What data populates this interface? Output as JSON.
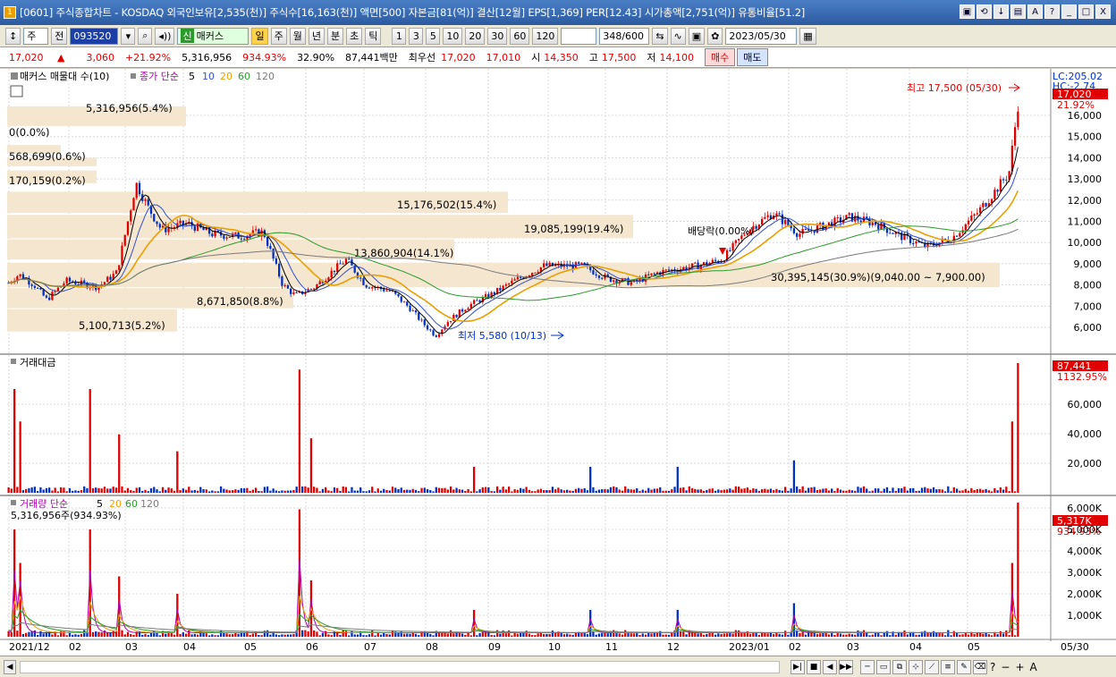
{
  "window": {
    "title": "[0601] 주식종합차트 - KOSDAQ 외국인보유[2,535(천)] 주식수[16,163(천)] 액면[500] 자본금[81(억)] 결산[12월] EPS[1,369] PER[12.43] 시가총액[2,751(억)] 유통비율[51.2]",
    "app_icon": "1",
    "buttons": [
      "▣",
      "⟲",
      "↓",
      "▤",
      "A",
      "?",
      "_",
      "□",
      "X"
    ]
  },
  "toolbar": {
    "type_label": "주",
    "prev_label": "전",
    "code": "093520",
    "name_prefix": "신",
    "name": "매커스",
    "periods": [
      "일",
      "주",
      "월",
      "년",
      "분",
      "초",
      "틱"
    ],
    "intervals": [
      "1",
      "3",
      "5",
      "10",
      "20",
      "30",
      "60",
      "120"
    ],
    "count": "348",
    "count_total": "/600",
    "date": "2023/05/30"
  },
  "quote": {
    "price": "17,020",
    "change_arrow": "▲",
    "change": "3,060",
    "change_pct": "+21.92%",
    "volume": "5,316,956",
    "volume_ratio": "934.93%",
    "turnover": "32.90%",
    "amount": "87,441백만",
    "best_ask_label": "최우선",
    "best_ask": "17,020",
    "best_bid": "17,010",
    "open_label": "시",
    "open": "14,350",
    "high_label": "고",
    "high": "17,500",
    "low_label": "저",
    "low": "14,100",
    "buy_label": "매수",
    "sell_label": "매도"
  },
  "price_panel": {
    "legend_name": "매커스 매물대 수(10)",
    "legend_ma": "종가 단순",
    "ma_periods": [
      "5",
      "10",
      "20",
      "60",
      "120"
    ],
    "lc_label": "LC:205.02",
    "hc_label": "HC:-2.74",
    "current_price": "17,020",
    "current_pct": "21.92%",
    "high_marker": "최고 17,500 (05/30)",
    "low_marker": "최저 5,580 (10/13)",
    "dividend_marker": "배당락(0.00%)",
    "volume_profile_labels": [
      "5,316,956(5.4%)",
      "0(0.0%)",
      "568,699(0.6%)",
      "170,159(0.2%)",
      "15,176,502(15.4%)",
      "19,085,199(19.4%)",
      "13,860,904(14.1%)",
      "30,395,145(30.9%)(9,040.00 ~ 7,900.00)",
      "8,671,850(8.8%)",
      "5,100,713(5.2%)"
    ],
    "axis_ticks": [
      "16,000",
      "15,000",
      "14,000",
      "13,000",
      "12,000",
      "11,000",
      "10,000",
      "9,000",
      "8,000",
      "7,000",
      "6,000"
    ]
  },
  "amount_panel": {
    "title": "거래대금",
    "current": "87,441",
    "current_pct": "1132.95%",
    "axis_ticks": [
      "60,000",
      "40,000",
      "20,000"
    ]
  },
  "volume_panel": {
    "legend": "거래량 단순",
    "ma_periods": [
      "5",
      "20",
      "60",
      "120"
    ],
    "info": "5,316,956주(934.93%)",
    "current": "5,317K",
    "current_pct": "934.93%",
    "axis_ticks": [
      "6,000K",
      "5,000K",
      "4,000K",
      "3,000K",
      "2,000K",
      "1,000K"
    ]
  },
  "x_axis": {
    "labels": [
      "2021/12",
      "02",
      "03",
      "04",
      "05",
      "06",
      "07",
      "08",
      "09",
      "10",
      "11",
      "12",
      "2023/01",
      "02",
      "03",
      "04",
      "05"
    ],
    "end_label": "05/30"
  },
  "bottom": {
    "controls": [
      "▶|",
      "■",
      "◀",
      "▶▶"
    ],
    "zoom_controls": [
      "?",
      "−",
      "+",
      "A"
    ]
  },
  "colors": {
    "up": "#e00000",
    "down": "#0030c0",
    "ma5": "#000000",
    "ma10": "#3050d0",
    "ma20": "#e8a000",
    "ma60": "#2a9a2a",
    "ma120": "#7a7a7a",
    "profile": "#f5e6d0"
  }
}
